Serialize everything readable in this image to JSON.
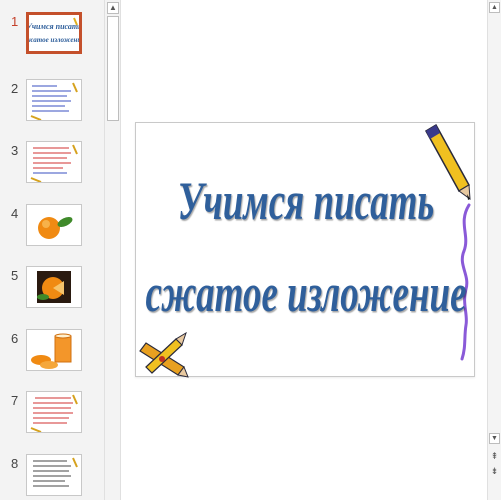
{
  "slides": [
    {
      "number": "1",
      "selected": true,
      "kind": "title"
    },
    {
      "number": "2",
      "selected": false,
      "kind": "text-blue"
    },
    {
      "number": "3",
      "selected": false,
      "kind": "text-red"
    },
    {
      "number": "4",
      "selected": false,
      "kind": "orange"
    },
    {
      "number": "5",
      "selected": false,
      "kind": "orange-dark"
    },
    {
      "number": "6",
      "selected": false,
      "kind": "juice"
    },
    {
      "number": "7",
      "selected": false,
      "kind": "text-red"
    },
    {
      "number": "8",
      "selected": false,
      "kind": "text-dark"
    }
  ],
  "slide": {
    "title_line1": "Учимся писать",
    "title_line2": "сжатое изложение",
    "title_color": "#2f5f9b"
  },
  "icons": {
    "scroll_up": "chevron-up-icon",
    "scroll_down": "chevron-down-icon",
    "prev_slide": "double-chevron-up-icon",
    "next_slide": "double-chevron-down-icon",
    "pencil": "pencil-clipart-icon",
    "crossed_pencils": "crossed-pencils-clipart-icon"
  }
}
